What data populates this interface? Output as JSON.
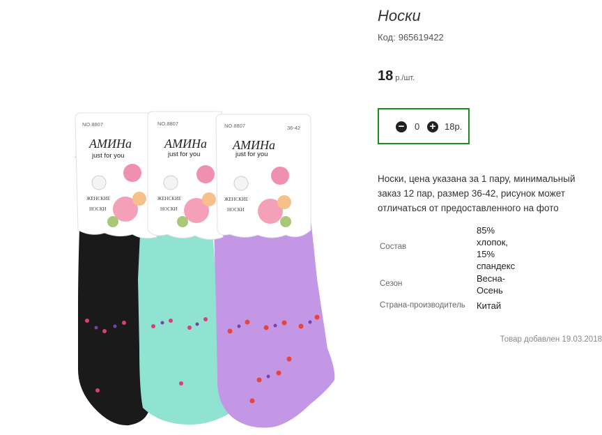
{
  "product": {
    "title": "Носки",
    "code_label": "Код:",
    "code_value": "965619422",
    "price": "18",
    "price_unit": "р./шт."
  },
  "quantity": {
    "value": "0",
    "total": "18р."
  },
  "description": "Носки, цена указана за 1 пару, минимальный заказ 12 пар, размер 36-42, рисунок может отличаться от предоставленного на фото",
  "properties": [
    {
      "label": "Состав",
      "value": "85% хлопок, 15% спандекс"
    },
    {
      "label": "Сезон",
      "value": "Весна-Осень"
    },
    {
      "label": "Страна-производитель",
      "value": "Китай"
    }
  ],
  "added_text": "Товар добавлен 19.03.2018",
  "image_labels": {
    "brand": "АМИНа",
    "tagline": "just for you",
    "model_no": "NO.8807",
    "size": "36-42",
    "type_line1": "ЖЕНСКИЕ",
    "type_line2": "НОСКИ"
  },
  "colors": {
    "accent_border": "#1d8a1d",
    "sock_black": "#1a1a1a",
    "sock_mint": "#8fe3d0",
    "sock_lilac": "#c496e6"
  }
}
